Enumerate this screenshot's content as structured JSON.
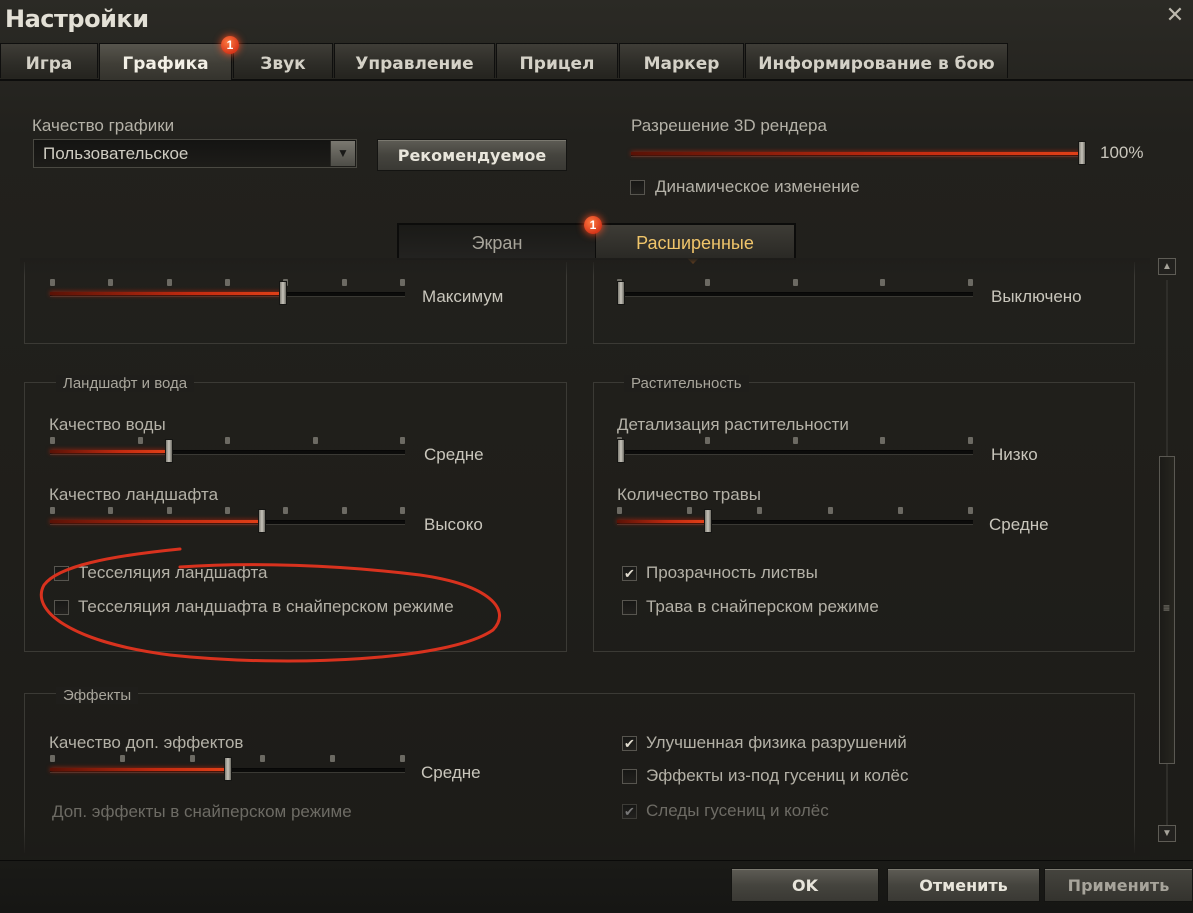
{
  "window": {
    "title": "Настройки"
  },
  "tabs": [
    {
      "label": "Игра"
    },
    {
      "label": "Графика",
      "badge": "1"
    },
    {
      "label": "Звук"
    },
    {
      "label": "Управление"
    },
    {
      "label": "Прицел"
    },
    {
      "label": "Маркер"
    },
    {
      "label": "Информирование в бою"
    }
  ],
  "quality": {
    "label": "Качество графики",
    "value": "Пользовательское",
    "recommended_label": "Рекомендуемое"
  },
  "render3d": {
    "label": "Разрешение 3D рендера",
    "value_text": "100%",
    "level": 1.0,
    "dynamic_label": "Динамическое изменение",
    "dynamic_checked": false
  },
  "subtabs": [
    {
      "label": "Экран",
      "badge": "1"
    },
    {
      "label": "Расширенные"
    }
  ],
  "top_partial": {
    "left_value": "Максимум",
    "left_level": 0.66,
    "right_value": "Выключено",
    "right_level": 0.0
  },
  "landscape": {
    "legend": "Ландшафт и вода",
    "water_label": "Качество воды",
    "water_value": "Средне",
    "water_level": 0.33,
    "terrain_label": "Качество ландшафта",
    "terrain_value": "Высоко",
    "terrain_level": 0.6,
    "tess_label": "Тесселяция ландшафта",
    "tess_checked": false,
    "tess_sniper_label": "Тесселяция ландшафта в снайперском режиме",
    "tess_sniper_checked": false
  },
  "vegetation": {
    "legend": "Растительность",
    "detail_label": "Детализация растительности",
    "detail_value": "Низко",
    "detail_level": 0.0,
    "grass_label": "Количество травы",
    "grass_value": "Средне",
    "grass_level": 0.25,
    "foliage_label": "Прозрачность листвы",
    "foliage_checked": true,
    "grass_sniper_label": "Трава в снайперском режиме",
    "grass_sniper_checked": false
  },
  "effects": {
    "legend": "Эффекты",
    "extra_label": "Качество доп. эффектов",
    "extra_value": "Средне",
    "extra_level": 0.5,
    "extra_sniper_label": "Доп. эффекты в снайперском режиме",
    "physics_label": "Улучшенная физика разрушений",
    "physics_checked": true,
    "tracks_fx_label": "Эффекты из-под гусениц и колёс",
    "tracks_fx_checked": false,
    "track_marks_label": "Следы гусениц и колёс",
    "track_marks_checked": true
  },
  "footer": {
    "ok": "OK",
    "cancel": "Отменить",
    "apply": "Применить"
  },
  "colors": {
    "accent": "#e04018",
    "highlight": "#f0c56a"
  }
}
